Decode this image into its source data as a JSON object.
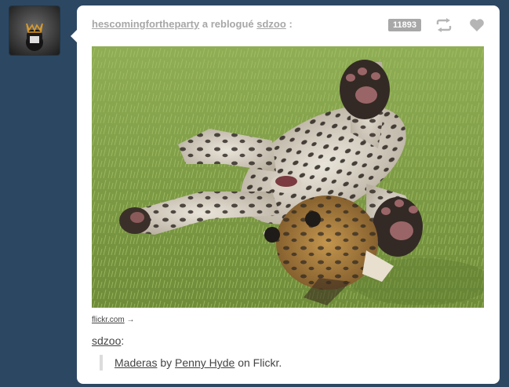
{
  "post": {
    "reblogger": "hescomingfortheparty",
    "reblog_phrase": "a reblogué",
    "source_blog": "sdzoo",
    "header_sep": ":",
    "notes_count": "11893",
    "icons": {
      "reblog": "reblog-icon",
      "like": "heart-icon"
    },
    "photo_caption_link": "flickr.com",
    "photo_caption_arrow": "→",
    "reblog_author": "sdzoo",
    "reblog_author_sep": ":",
    "quote": {
      "title": "Maderas",
      "by": "by",
      "author": "Penny Hyde",
      "on": "on Flickr."
    }
  },
  "colors": {
    "background": "#2c4762",
    "post_bg": "#ffffff",
    "muted_text": "#a7a7a7",
    "badge_bg": "#a8a8a8"
  }
}
